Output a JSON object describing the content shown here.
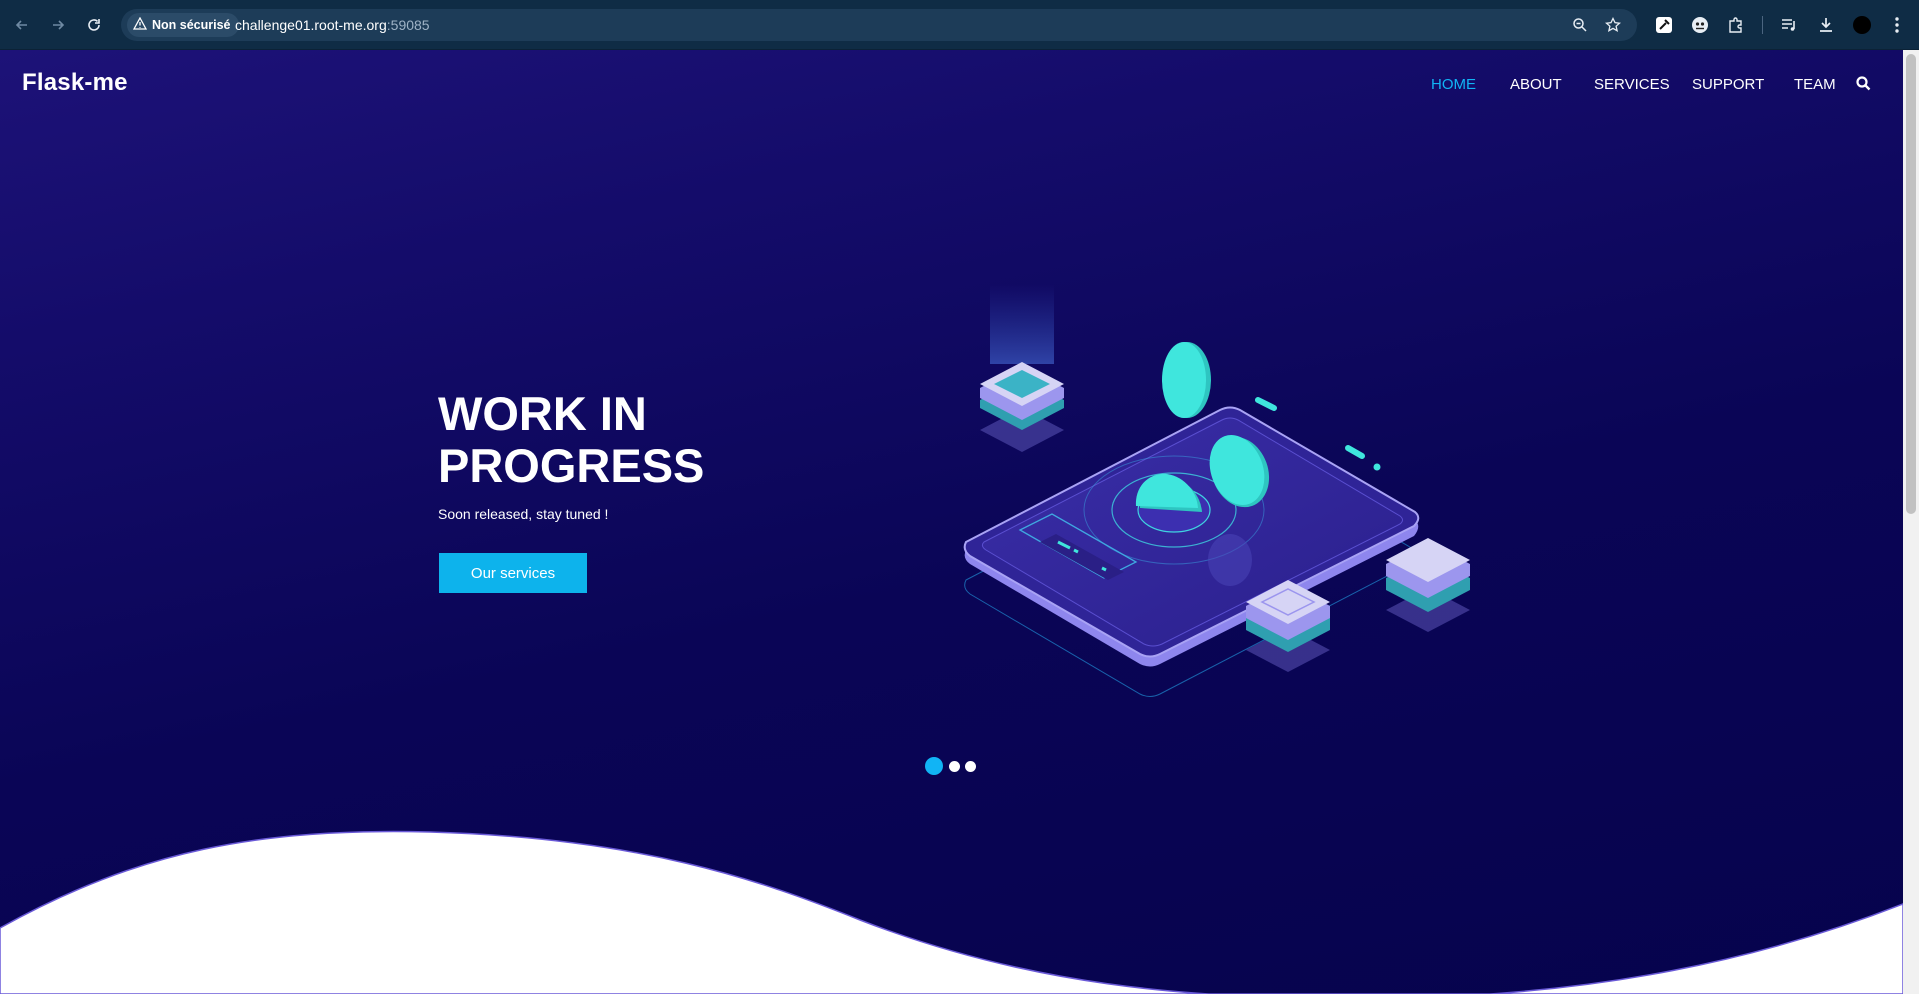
{
  "browser": {
    "security_label": "Non sécurisé",
    "url_host": "challenge01.root-me.org",
    "url_port": ":59085",
    "icons": [
      "back-icon",
      "forward-icon",
      "reload-icon",
      "warning-icon",
      "zoom-icon",
      "star-icon",
      "eyedropper-icon",
      "extension-icon",
      "puzzle-icon",
      "media-icon",
      "download-icon",
      "profile-icon",
      "menu-icon"
    ]
  },
  "site": {
    "brand": "Flask-me",
    "nav": [
      {
        "label": "HOME",
        "active": true
      },
      {
        "label": "ABOUT",
        "active": false
      },
      {
        "label": "SERVICES",
        "active": false
      },
      {
        "label": "SUPPORT",
        "active": false
      },
      {
        "label": "TEAM",
        "active": false
      }
    ],
    "hero": {
      "title": "WORK IN PROGRESS",
      "subtitle": "Soon released, stay tuned !",
      "cta": "Our services"
    },
    "slider": {
      "slides": 3,
      "active_index": 0
    }
  },
  "colors": {
    "hero_top": "#1d1278",
    "hero_bottom": "#06034d",
    "accent": "#11b4f5",
    "button": "#0db3ec",
    "chrome": "#0f2c45",
    "omnibox": "#1d3c58",
    "coin": "#3fe6dd",
    "block_top": "#d6d4f5"
  }
}
